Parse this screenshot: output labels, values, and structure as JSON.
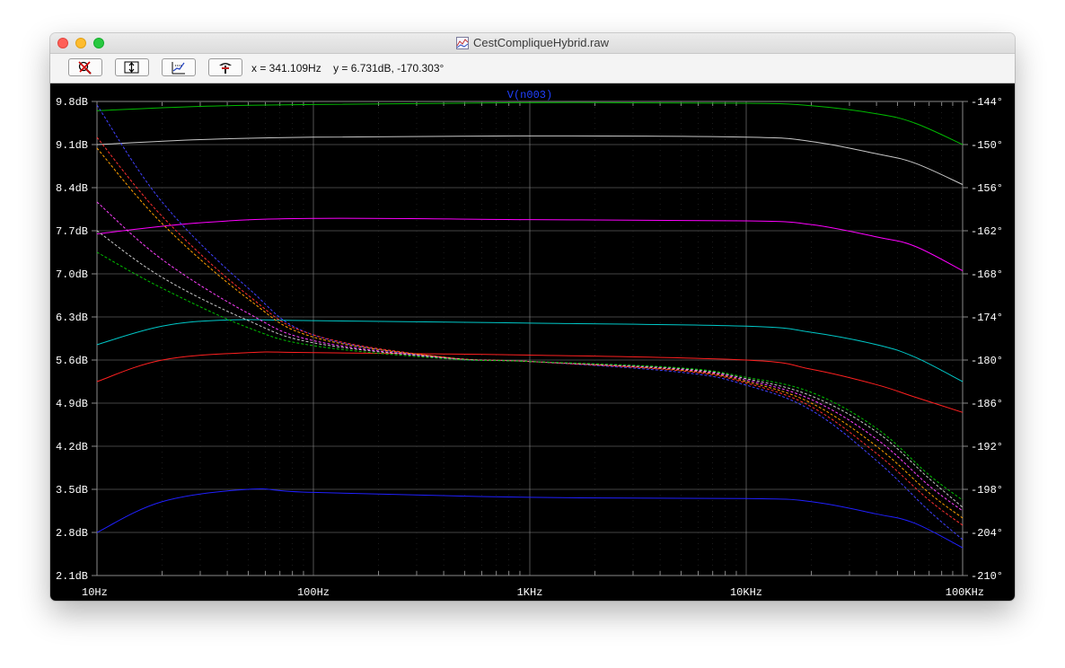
{
  "window": {
    "title": "CestCompliqueHybrid.raw"
  },
  "toolbar": {
    "buttons": [
      {
        "name": "zoom-cancel",
        "icon": "zoom-cancel-icon"
      },
      {
        "name": "autorange-y",
        "icon": "autorange-y-icon"
      },
      {
        "name": "autorange-x",
        "icon": "autorange-x-icon"
      },
      {
        "name": "pick-trace",
        "icon": "probe-icon"
      }
    ],
    "cursor_x": "x = 341.109Hz",
    "cursor_y": "y = 6.731dB, -170.303°"
  },
  "chart_data": {
    "type": "line",
    "title": "V(n003)",
    "x_scale": "log",
    "xlim": [
      10,
      100000
    ],
    "x_ticks": [
      10,
      100,
      1000,
      10000,
      100000
    ],
    "x_tick_labels": [
      "10Hz",
      "100Hz",
      "1KHz",
      "10KHz",
      "100KHz"
    ],
    "ylim_left": [
      2.1,
      9.8
    ],
    "y_left_ticks": [
      2.1,
      2.8,
      3.5,
      4.2,
      4.9,
      5.6,
      6.3,
      7.0,
      7.7,
      8.4,
      9.1,
      9.8
    ],
    "y_left_labels": [
      "2.1dB",
      "2.8dB",
      "3.5dB",
      "4.2dB",
      "4.9dB",
      "5.6dB",
      "6.3dB",
      "7.0dB",
      "7.7dB",
      "8.4dB",
      "9.1dB",
      "9.8dB"
    ],
    "ylim_right": [
      -210,
      -144
    ],
    "y_right_ticks": [
      -210,
      -204,
      -198,
      -192,
      -186,
      -180,
      -174,
      -168,
      -162,
      -156,
      -150,
      -144
    ],
    "y_right_labels": [
      "-210°",
      "-204°",
      "-198°",
      "-192°",
      "-186°",
      "-180°",
      "-174°",
      "-168°",
      "-162°",
      "-156°",
      "-150°",
      "-144°"
    ],
    "grid": true,
    "series": [
      {
        "color": "#00bb00",
        "axis": "left",
        "dash": false,
        "x": [
          10,
          30,
          100,
          1000,
          10000,
          20000,
          40000,
          60000,
          100000
        ],
        "y": [
          9.65,
          9.72,
          9.75,
          9.78,
          9.77,
          9.73,
          9.6,
          9.45,
          9.1
        ]
      },
      {
        "color": "#c8c8c8",
        "axis": "left",
        "dash": false,
        "x": [
          10,
          30,
          100,
          1000,
          10000,
          20000,
          40000,
          60000,
          100000
        ],
        "y": [
          9.1,
          9.18,
          9.22,
          9.24,
          9.22,
          9.15,
          8.95,
          8.8,
          8.45
        ]
      },
      {
        "color": "#ff00ff",
        "axis": "left",
        "dash": false,
        "x": [
          10,
          30,
          100,
          1000,
          10000,
          20000,
          40000,
          60000,
          100000
        ],
        "y": [
          7.65,
          7.83,
          7.9,
          7.88,
          7.86,
          7.8,
          7.6,
          7.45,
          7.05
        ]
      },
      {
        "color": "#00c8c8",
        "axis": "left",
        "dash": false,
        "x": [
          10,
          20,
          40,
          100,
          1000,
          10000,
          20000,
          40000,
          60000,
          100000
        ],
        "y": [
          5.85,
          6.15,
          6.25,
          6.24,
          6.2,
          6.15,
          6.05,
          5.85,
          5.65,
          5.25
        ]
      },
      {
        "color": "#ff2020",
        "axis": "left",
        "dash": false,
        "x": [
          10,
          20,
          50,
          100,
          1000,
          10000,
          20000,
          40000,
          60000,
          100000
        ],
        "y": [
          5.25,
          5.6,
          5.72,
          5.72,
          5.68,
          5.6,
          5.45,
          5.2,
          5.0,
          4.75
        ]
      },
      {
        "color": "#2020ff",
        "axis": "left",
        "dash": false,
        "x": [
          10,
          20,
          50,
          100,
          1000,
          10000,
          20000,
          40000,
          60000,
          100000
        ],
        "y": [
          2.8,
          3.3,
          3.5,
          3.45,
          3.37,
          3.35,
          3.3,
          3.1,
          2.95,
          2.55
        ]
      },
      {
        "color": "#4040ff",
        "axis": "right",
        "dash": true,
        "x": [
          10,
          20,
          50,
          100,
          400,
          1000,
          5000,
          10000,
          20000,
          40000,
          70000,
          100000
        ],
        "y": [
          -144.5,
          -158,
          -170,
          -176.5,
          -179.7,
          -180.2,
          -181.7,
          -183.5,
          -187,
          -194,
          -201,
          -205
        ]
      },
      {
        "color": "#ff3030",
        "axis": "right",
        "dash": true,
        "x": [
          10,
          20,
          50,
          100,
          400,
          1000,
          5000,
          10000,
          20000,
          40000,
          70000,
          100000
        ],
        "y": [
          -149,
          -160,
          -171,
          -176.5,
          -179.6,
          -180.2,
          -181.5,
          -183.2,
          -186.5,
          -193,
          -199.5,
          -203
        ]
      },
      {
        "color": "#ffa000",
        "axis": "right",
        "dash": true,
        "x": [
          10,
          20,
          50,
          100,
          400,
          1000,
          5000,
          10000,
          20000,
          40000,
          70000,
          100000
        ],
        "y": [
          -150.5,
          -161,
          -171.5,
          -176.8,
          -179.6,
          -180.2,
          -181.4,
          -183,
          -186,
          -192,
          -198.5,
          -202
        ]
      },
      {
        "color": "#ff40ff",
        "axis": "right",
        "dash": true,
        "x": [
          10,
          20,
          50,
          100,
          400,
          1000,
          5000,
          10000,
          20000,
          40000,
          70000,
          100000
        ],
        "y": [
          -158,
          -166,
          -173.5,
          -177.3,
          -179.7,
          -180.2,
          -181.3,
          -182.8,
          -185.5,
          -191,
          -197.5,
          -201
        ]
      },
      {
        "color": "#c8c8c8",
        "axis": "right",
        "dash": true,
        "x": [
          10,
          20,
          50,
          100,
          400,
          1000,
          5000,
          10000,
          20000,
          40000,
          70000,
          100000
        ],
        "y": [
          -162,
          -168.5,
          -174.5,
          -177.6,
          -179.7,
          -180.2,
          -181.2,
          -182.6,
          -185,
          -190,
          -196.5,
          -200.5
        ]
      },
      {
        "color": "#00c000",
        "axis": "right",
        "dash": true,
        "x": [
          10,
          20,
          50,
          100,
          400,
          1000,
          5000,
          10000,
          20000,
          40000,
          70000,
          100000
        ],
        "y": [
          -165,
          -170,
          -175.5,
          -178,
          -179.8,
          -180.2,
          -181.1,
          -182.4,
          -184.5,
          -189.5,
          -196,
          -199.5
        ]
      }
    ]
  }
}
